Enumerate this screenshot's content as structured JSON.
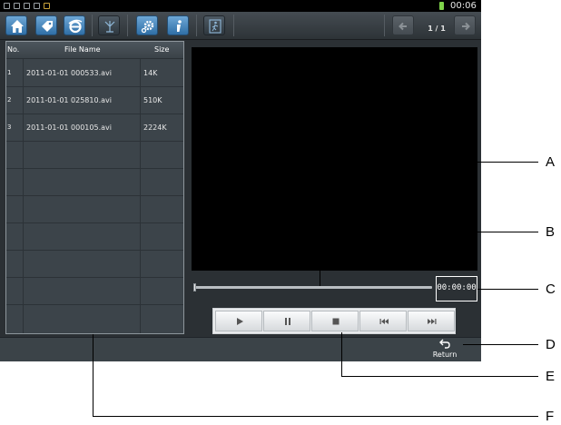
{
  "status_bar": {
    "time": "00:06"
  },
  "toolbar": {
    "buttons": [
      "home-icon",
      "tag-icon",
      "browser-icon",
      "antenna-icon",
      "settings-icon",
      "info-icon",
      "exit-icon"
    ],
    "page_indicator": "1 / 1"
  },
  "file_list": {
    "headers": {
      "no": "No.",
      "name": "File Name",
      "size": "Size"
    },
    "rows": [
      {
        "no": "1",
        "name": "2011-01-01 000533.avi",
        "size": "14K"
      },
      {
        "no": "2",
        "name": "2011-01-01 025810.avi",
        "size": "510K"
      },
      {
        "no": "3",
        "name": "2011-01-01 000105.avi",
        "size": "2224K"
      }
    ]
  },
  "player": {
    "time_display": "00:00:00",
    "progress_fraction": 0.0,
    "controls": [
      "play",
      "pause",
      "stop",
      "previous",
      "next"
    ]
  },
  "bottom_bar": {
    "return_label": "Return"
  },
  "callouts": [
    "A",
    "B",
    "C",
    "D",
    "E",
    "F"
  ]
}
